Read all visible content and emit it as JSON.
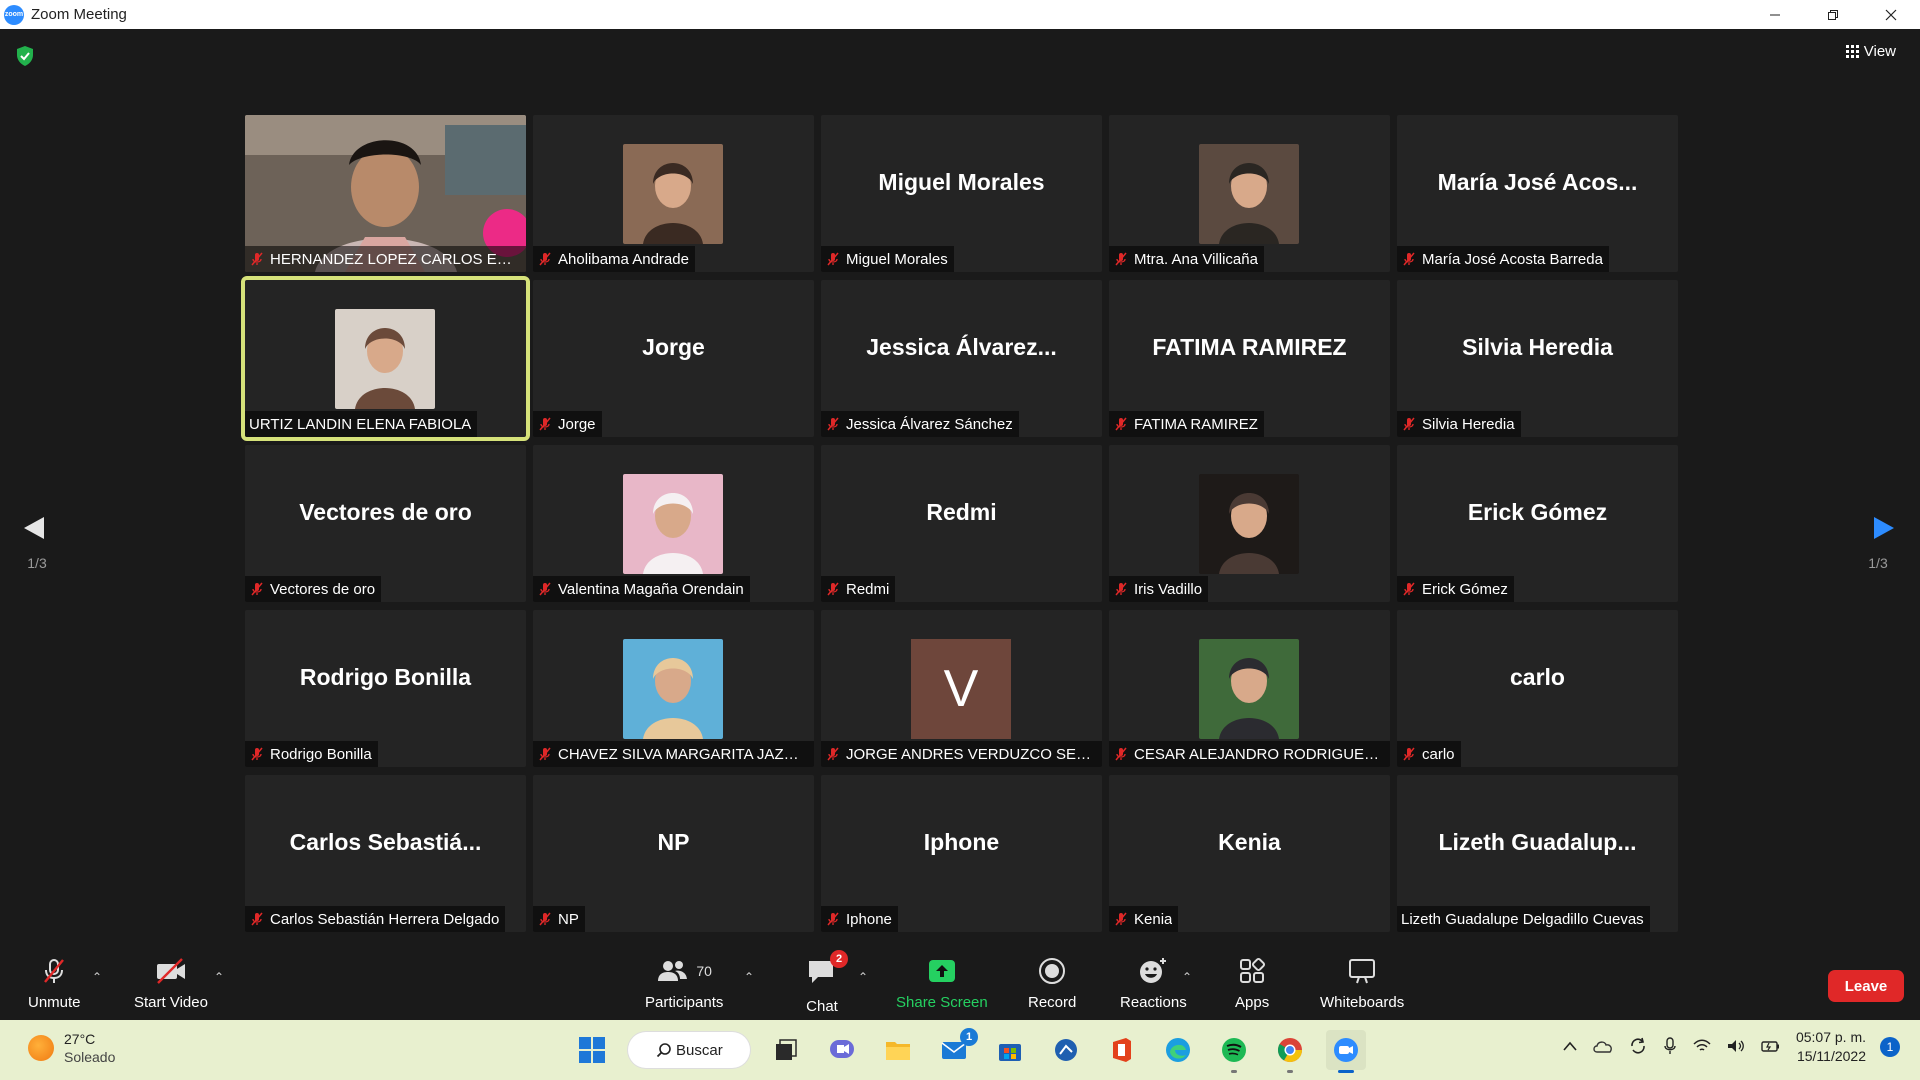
{
  "window": {
    "title": "Zoom Meeting",
    "app_logo_text": "zoom"
  },
  "view": {
    "label": "View"
  },
  "pagination": {
    "left": "1/3",
    "right": "1/3"
  },
  "participants": [
    {
      "display_name": "",
      "caption": "HERNANDEZ LOPEZ CARLOS EDU...",
      "type": "video",
      "muted": true
    },
    {
      "display_name": "",
      "caption": "Aholibama Andrade",
      "type": "photo",
      "muted": true
    },
    {
      "display_name": "Miguel Morales",
      "caption": "Miguel Morales",
      "type": "name",
      "muted": true
    },
    {
      "display_name": "",
      "caption": "Mtra. Ana Villicaña",
      "type": "photo",
      "muted": true
    },
    {
      "display_name": "María José Acos...",
      "caption": "María José Acosta Barreda",
      "type": "name",
      "muted": true
    },
    {
      "display_name": "",
      "caption": "URTIZ LANDIN ELENA FABIOLA",
      "type": "photo",
      "muted": false,
      "active_speaker": true
    },
    {
      "display_name": "Jorge",
      "caption": "Jorge",
      "type": "name",
      "muted": true
    },
    {
      "display_name": "Jessica  Álvarez...",
      "caption": "Jessica Álvarez Sánchez",
      "type": "name",
      "muted": true
    },
    {
      "display_name": "FATIMA RAMIREZ",
      "caption": "FATIMA RAMIREZ",
      "type": "name",
      "muted": true
    },
    {
      "display_name": "Silvia Heredia",
      "caption": "Silvia Heredia",
      "type": "name",
      "muted": true
    },
    {
      "display_name": "Vectores de oro",
      "caption": "Vectores de oro",
      "type": "name",
      "muted": true
    },
    {
      "display_name": "",
      "caption": "Valentina Magaña Orendain",
      "type": "photo",
      "muted": true
    },
    {
      "display_name": "Redmi",
      "caption": "Redmi",
      "type": "name",
      "muted": true
    },
    {
      "display_name": "",
      "caption": "Iris Vadillo",
      "type": "photo",
      "muted": true
    },
    {
      "display_name": "Erick Gómez",
      "caption": "Erick Gómez",
      "type": "name",
      "muted": true
    },
    {
      "display_name": "Rodrigo Bonilla",
      "caption": "Rodrigo Bonilla",
      "type": "name",
      "muted": true
    },
    {
      "display_name": "",
      "caption": "CHAVEZ SILVA MARGARITA JAZMI...",
      "type": "photo",
      "muted": true
    },
    {
      "display_name": "V",
      "caption": "JORGE ANDRES VERDUZCO SERR...",
      "type": "letter",
      "muted": true
    },
    {
      "display_name": "",
      "caption": "CESAR ALEJANDRO RODRIGUEZ ...",
      "type": "photo",
      "muted": true
    },
    {
      "display_name": "carlo",
      "caption": "carlo",
      "type": "name",
      "muted": true
    },
    {
      "display_name": "Carlos  Sebastiá...",
      "caption": "Carlos Sebastián Herrera Delgado",
      "type": "name",
      "muted": true
    },
    {
      "display_name": "NP",
      "caption": "NP",
      "type": "name",
      "muted": true
    },
    {
      "display_name": "Iphone",
      "caption": "Iphone",
      "type": "name",
      "muted": true
    },
    {
      "display_name": "Kenia",
      "caption": "Kenia",
      "type": "name",
      "muted": true
    },
    {
      "display_name": "Lizeth  Guadalup...",
      "caption": "Lizeth Guadalupe Delgadillo Cuevas",
      "type": "name",
      "muted": false
    }
  ],
  "toolbar": {
    "unmute": "Unmute",
    "start_video": "Start Video",
    "participants": "Participants",
    "participants_count": "70",
    "chat": "Chat",
    "chat_badge": "2",
    "share_screen": "Share Screen",
    "record": "Record",
    "reactions": "Reactions",
    "apps": "Apps",
    "whiteboards": "Whiteboards",
    "leave": "Leave"
  },
  "taskbar": {
    "temperature": "27°C",
    "condition": "Soleado",
    "search": "Buscar",
    "mail_badge": "1",
    "time": "05:07 p. m.",
    "date": "15/11/2022",
    "notifications": "1"
  },
  "colors": {
    "background": "#1a1a1a",
    "tile": "#242424",
    "active_speaker": "#d6e27a",
    "leave": "#e02828",
    "share": "#25d061",
    "muted": "#e02828",
    "taskbar": "#e8f0cf"
  }
}
